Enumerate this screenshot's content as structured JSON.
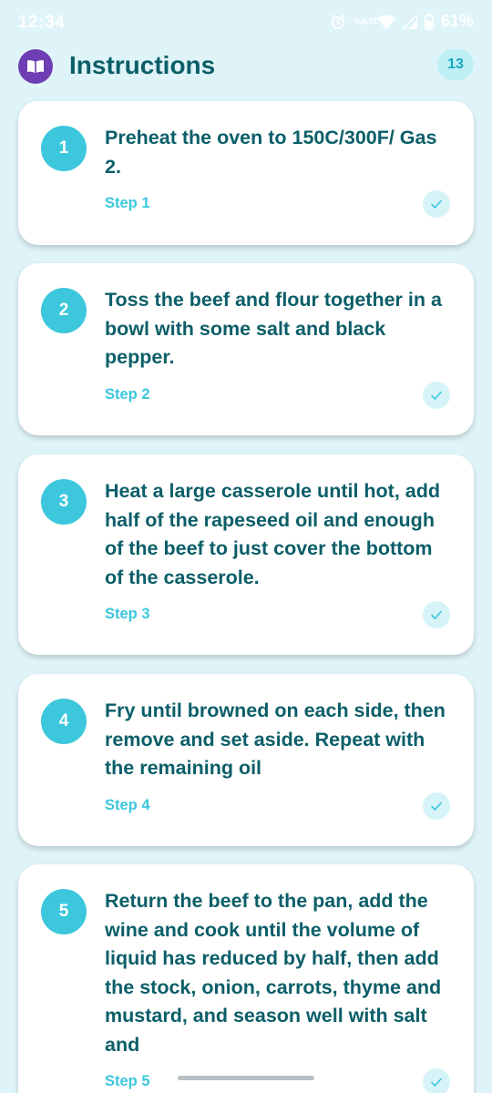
{
  "status_bar": {
    "time": "12:34",
    "volte_top": "Vo)",
    "volte_bottom": "LTE",
    "battery": "61%",
    "icons": [
      "alarm-icon",
      "volte-icon",
      "wifi-icon",
      "signal-icon",
      "battery-icon"
    ]
  },
  "header": {
    "title": "Instructions",
    "count": "13",
    "logo_icon": "book-icon",
    "logo_color": "#6f3db3"
  },
  "colors": {
    "background": "#dff4f8",
    "title": "#0b5e68",
    "accent": "#3cc7dd"
  },
  "steps": [
    {
      "number": "1",
      "text": "Preheat the oven to 150C/300F/ Gas 2.",
      "label": "Step 1"
    },
    {
      "number": "2",
      "text": "Toss the beef and flour together in a bowl with some salt and black pepper.",
      "label": "Step 2"
    },
    {
      "number": "3",
      "text": "Heat a large casserole until hot, add half of the rapeseed oil and enough of the beef to just cover the bottom of the casserole.",
      "label": "Step 3"
    },
    {
      "number": "4",
      "text": "Fry until browned on each side, then remove and set aside. Repeat with the remaining oil",
      "label": "Step 4"
    },
    {
      "number": "5",
      "text": "Return the beef to the pan, add the wine and cook until the volume of liquid has reduced by half, then add the stock, onion, carrots, thyme and mustard, and season well with salt and",
      "label": "Step 5"
    }
  ]
}
